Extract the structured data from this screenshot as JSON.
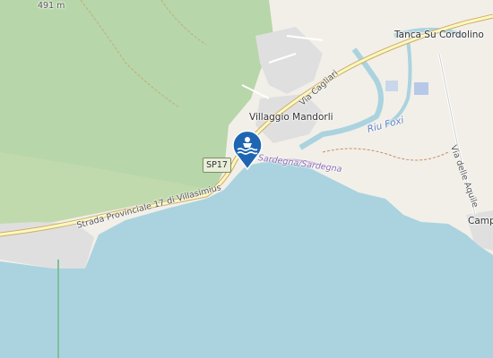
{
  "map": {
    "labels": {
      "elevation": "491 m",
      "tanca": "Tanca Su Cordolino",
      "villaggio": "Villaggio Mandorli",
      "via_cagliari": "Via Cagliari",
      "riu_foxi": "Riu Foxi",
      "via_aquile": "Via delle Aquile",
      "campo": "Camp",
      "strada": "Strada Provinciale 17 di Villasimius",
      "sardegna": "Sardegna/Sardegna"
    },
    "shield": "SP17",
    "marker": {
      "icon": "swimming-icon",
      "color": "#1f66b2"
    },
    "colors": {
      "sea": "#aad3df",
      "land": "#f2efe9",
      "forest": "#add19e",
      "residential": "#e0dfdf",
      "road": "#f7fabf"
    }
  }
}
